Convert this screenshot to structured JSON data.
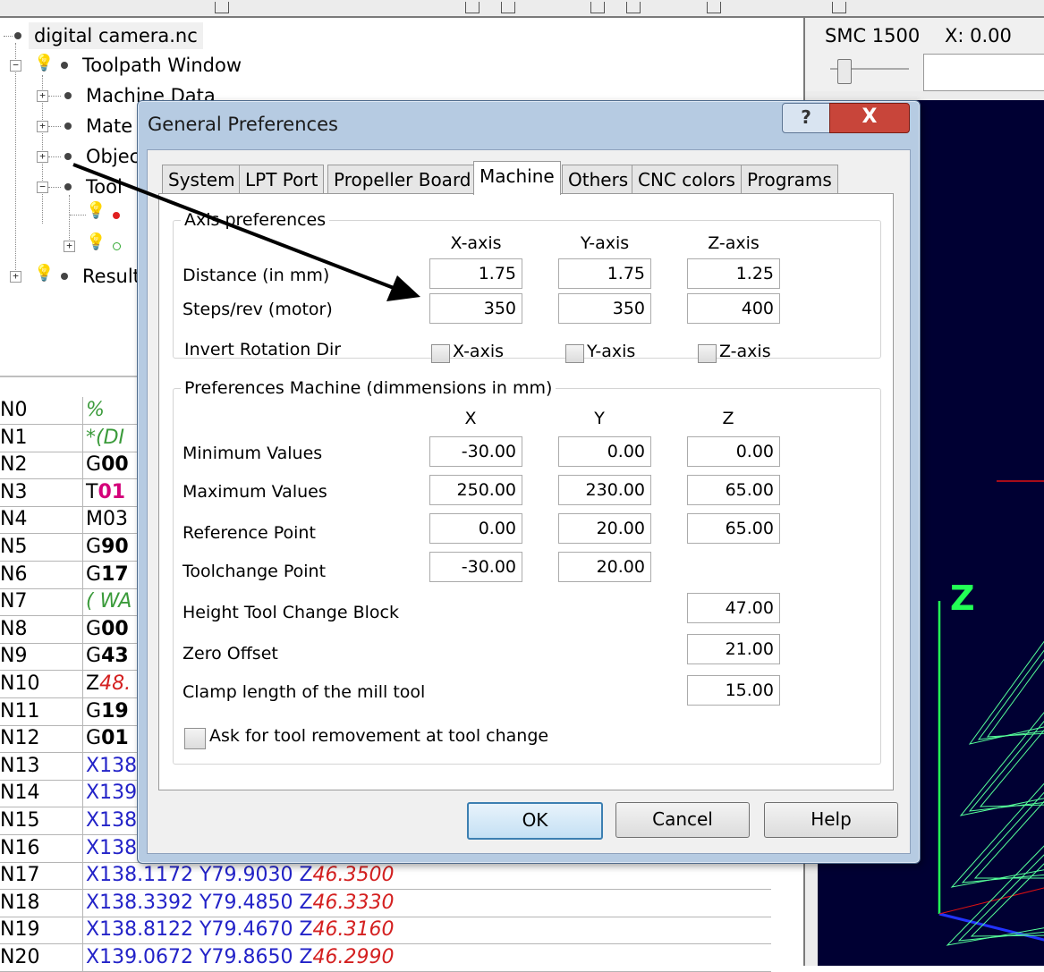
{
  "tree": {
    "root": "digital camera.nc",
    "toolpath": "Toolpath Window",
    "items": [
      "Machine Data",
      "Mate",
      "Objec",
      "Tool"
    ],
    "result": "Result"
  },
  "code": {
    "rows": [
      {
        "n": "N0",
        "parts": [
          {
            "t": "%",
            "c": "g"
          }
        ]
      },
      {
        "n": "N1",
        "parts": [
          {
            "t": "*(DI",
            "c": "g"
          }
        ]
      },
      {
        "n": "N2",
        "parts": [
          {
            "t": "G",
            "c": "k"
          },
          {
            "t": "00",
            "c": "k b"
          }
        ]
      },
      {
        "n": "N3",
        "parts": [
          {
            "t": "T",
            "c": "k"
          },
          {
            "t": "01",
            "c": "m"
          }
        ]
      },
      {
        "n": "N4",
        "parts": [
          {
            "t": "M03",
            "c": "k"
          }
        ]
      },
      {
        "n": "N5",
        "parts": [
          {
            "t": "G",
            "c": "k"
          },
          {
            "t": "90",
            "c": "k b"
          }
        ]
      },
      {
        "n": "N6",
        "parts": [
          {
            "t": "G",
            "c": "k"
          },
          {
            "t": "17",
            "c": "k b"
          }
        ]
      },
      {
        "n": "N7",
        "parts": [
          {
            "t": "( WA",
            "c": "g"
          }
        ]
      },
      {
        "n": "N8",
        "parts": [
          {
            "t": "G",
            "c": "k"
          },
          {
            "t": "00",
            "c": "k b"
          }
        ]
      },
      {
        "n": "N9",
        "parts": [
          {
            "t": "G",
            "c": "k"
          },
          {
            "t": "43",
            "c": "k b"
          }
        ]
      },
      {
        "n": "N10",
        "parts": [
          {
            "t": "Z",
            "c": "k"
          },
          {
            "t": "48.",
            "c": "r"
          }
        ]
      },
      {
        "n": "N11",
        "parts": [
          {
            "t": "G",
            "c": "k"
          },
          {
            "t": "19",
            "c": "k b"
          }
        ]
      },
      {
        "n": "N12",
        "parts": [
          {
            "t": "G",
            "c": "k"
          },
          {
            "t": "01",
            "c": "k b"
          }
        ]
      },
      {
        "n": "N13",
        "parts": [
          {
            "t": "X138",
            "c": "x"
          }
        ]
      },
      {
        "n": "N14",
        "parts": [
          {
            "t": "X139",
            "c": "x"
          }
        ]
      },
      {
        "n": "N15",
        "parts": [
          {
            "t": "X138",
            "c": "x"
          }
        ]
      },
      {
        "n": "N16",
        "parts": [
          {
            "t": "X138",
            "c": "x"
          }
        ]
      },
      {
        "n": "N17",
        "parts": [
          {
            "t": "X138.1172 ",
            "c": "x"
          },
          {
            "t": "Y79.9030 ",
            "c": "x"
          },
          {
            "t": "Z",
            "c": "x"
          },
          {
            "t": "46.3500",
            "c": "r"
          }
        ]
      },
      {
        "n": "N18",
        "parts": [
          {
            "t": "X138.3392 ",
            "c": "x"
          },
          {
            "t": "Y79.4850 ",
            "c": "x"
          },
          {
            "t": "Z",
            "c": "x"
          },
          {
            "t": "46.3330",
            "c": "r"
          }
        ]
      },
      {
        "n": "N19",
        "parts": [
          {
            "t": "X138.8122 ",
            "c": "x"
          },
          {
            "t": "Y79.4670 ",
            "c": "x"
          },
          {
            "t": "Z",
            "c": "x"
          },
          {
            "t": "46.3160",
            "c": "r"
          }
        ]
      },
      {
        "n": "N20",
        "parts": [
          {
            "t": "X139.0672 ",
            "c": "x"
          },
          {
            "t": "Y79.8650 ",
            "c": "x"
          },
          {
            "t": "Z",
            "c": "x"
          },
          {
            "t": "46.2990",
            "c": "r"
          }
        ]
      }
    ]
  },
  "right": {
    "smc": "SMC 1500",
    "x": "X: 0.00",
    "z_label": "Z"
  },
  "dialog": {
    "title": "General Preferences",
    "help_glyph": "?",
    "close_glyph": "X",
    "tabs": [
      "System",
      "LPT Port",
      "Propeller Board",
      "Machine",
      "Others",
      "CNC colors",
      "Programs"
    ],
    "active_tab": "Machine",
    "axis": {
      "legend": "Axis preferences",
      "headers": [
        "X-axis",
        "Y-axis",
        "Z-axis"
      ],
      "distance_label": "Distance (in mm)",
      "distance": [
        "1.75",
        "1.75",
        "1.25"
      ],
      "steps_label": "Steps/rev (motor)",
      "steps": [
        "350",
        "350",
        "400"
      ],
      "invert_label": "Invert Rotation Dir",
      "invert": [
        "X-axis",
        "Y-axis",
        "Z-axis"
      ]
    },
    "machine": {
      "legend": "Preferences Machine (dimmensions in mm)",
      "headers": [
        "X",
        "Y",
        "Z"
      ],
      "min_label": "Minimum Values",
      "min": [
        "-30.00",
        "0.00",
        "0.00"
      ],
      "max_label": "Maximum Values",
      "max": [
        "250.00",
        "230.00",
        "65.00"
      ],
      "ref_label": "Reference Point",
      "ref": [
        "0.00",
        "20.00",
        "65.00"
      ],
      "toolchange_label": "Toolchange Point",
      "toolchange": [
        "-30.00",
        "20.00"
      ],
      "height_label": "Height Tool Change Block",
      "height": "47.00",
      "zero_label": "Zero Offset",
      "zero": "21.00",
      "clamp_label": "Clamp length of the mill tool",
      "clamp": "15.00",
      "ask_label": "Ask for tool removement at tool change"
    },
    "buttons": {
      "ok": "OK",
      "cancel": "Cancel",
      "help": "Help"
    }
  },
  "colors": {
    "canvas": "#000033",
    "close": "#c8453a",
    "grid": "#55ff99"
  }
}
